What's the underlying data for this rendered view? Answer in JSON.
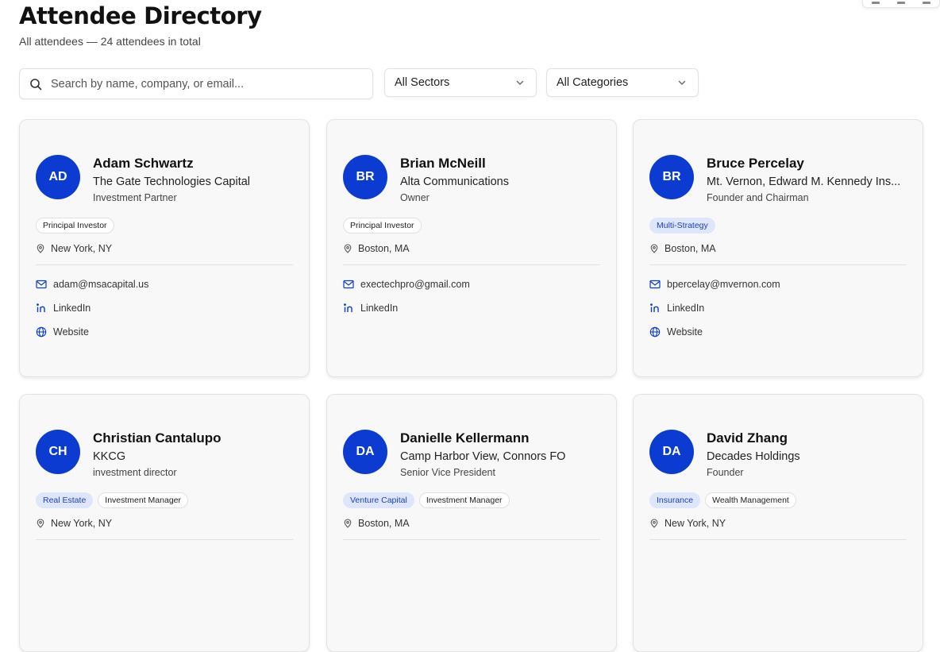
{
  "header": {
    "title": "Attendee Directory",
    "subtitle": "All attendees — 24 attendees in total"
  },
  "filters": {
    "search_placeholder": "Search by name, company, or email...",
    "sector_selected": "All Sectors",
    "category_selected": "All Categories"
  },
  "contact_labels": {
    "linkedin": "LinkedIn",
    "website": "Website"
  },
  "colors": {
    "accent": "#0b3bd1",
    "tag_blue_bg": "#dde6fb"
  },
  "attendees": [
    {
      "initials": "AD",
      "name": "Adam Schwartz",
      "company": "The Gate Technologies Capital",
      "role": "Investment Partner",
      "tags": [
        {
          "label": "Principal Investor",
          "style": "gray"
        }
      ],
      "location": "New York, NY",
      "email": "adam@msacapital.us",
      "has_linkedin": true,
      "has_website": true
    },
    {
      "initials": "BR",
      "name": "Brian McNeill",
      "company": "Alta Communications",
      "role": "Owner",
      "tags": [
        {
          "label": "Principal Investor",
          "style": "gray"
        }
      ],
      "location": "Boston, MA",
      "email": "exectechpro@gmail.com",
      "has_linkedin": true,
      "has_website": false
    },
    {
      "initials": "BR",
      "name": "Bruce Percelay",
      "company": "Mt. Vernon, Edward M. Kennedy Ins...",
      "role": "Founder and Chairman",
      "tags": [
        {
          "label": "Multi-Strategy",
          "style": "blue"
        }
      ],
      "location": "Boston, MA",
      "email": "bpercelay@mvernon.com",
      "has_linkedin": true,
      "has_website": true
    },
    {
      "initials": "CH",
      "name": "Christian Cantalupo",
      "company": "KKCG",
      "role": "investment director",
      "tags": [
        {
          "label": "Real Estate",
          "style": "blue"
        },
        {
          "label": "Investment Manager",
          "style": "gray"
        }
      ],
      "location": "New York, NY",
      "email": "",
      "has_linkedin": false,
      "has_website": false
    },
    {
      "initials": "DA",
      "name": "Danielle Kellermann",
      "company": "Camp Harbor View, Connors FO",
      "role": "Senior Vice President",
      "tags": [
        {
          "label": "Venture Capital",
          "style": "blue"
        },
        {
          "label": "Investment Manager",
          "style": "gray"
        }
      ],
      "location": "Boston, MA",
      "email": "",
      "has_linkedin": false,
      "has_website": false
    },
    {
      "initials": "DA",
      "name": "David Zhang",
      "company": "Decades Holdings",
      "role": "Founder",
      "tags": [
        {
          "label": "Insurance",
          "style": "blue"
        },
        {
          "label": "Wealth Management",
          "style": "gray"
        }
      ],
      "location": "New York, NY",
      "email": "",
      "has_linkedin": false,
      "has_website": false
    }
  ]
}
